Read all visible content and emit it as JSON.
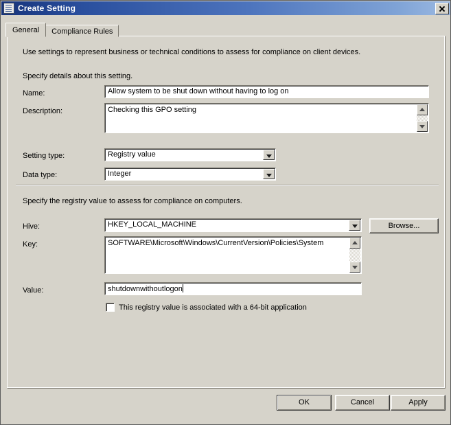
{
  "window": {
    "title": "Create Setting",
    "icon": "settings-document-icon",
    "close_label": "×"
  },
  "tabs": [
    {
      "label": "General",
      "active": true
    },
    {
      "label": "Compliance Rules",
      "active": false
    }
  ],
  "general": {
    "intro_text": "Use settings to represent business or technical conditions to assess for compliance on client devices.",
    "details_heading": "Specify details about this setting.",
    "name": {
      "label": "Name:",
      "value": "Allow system to be shut down without having to log on"
    },
    "description": {
      "label": "Description:",
      "value": "Checking this GPO setting"
    },
    "setting_type": {
      "label": "Setting type:",
      "value": "Registry value"
    },
    "data_type": {
      "label": "Data type:",
      "value": "Integer"
    },
    "registry_heading": "Specify the registry value to assess for compliance on computers.",
    "hive": {
      "label": "Hive:",
      "value": "HKEY_LOCAL_MACHINE"
    },
    "browse_label": "Browse...",
    "key": {
      "label": "Key:",
      "value": "SOFTWARE\\Microsoft\\Windows\\CurrentVersion\\Policies\\System"
    },
    "value_field": {
      "label": "Value:",
      "value": "shutdownwithoutlogon"
    },
    "sixtyfour_bit": {
      "label": "This registry value is associated with a 64-bit application",
      "checked": false
    }
  },
  "footer": {
    "ok_label": "OK",
    "cancel_label": "Cancel",
    "apply_label": "Apply"
  },
  "colors": {
    "dialog_face": "#d6d3ca",
    "title_gradient_start": "#16337b",
    "title_gradient_end": "#9cb9e2",
    "text": "#000000",
    "field_bg": "#ffffff"
  }
}
